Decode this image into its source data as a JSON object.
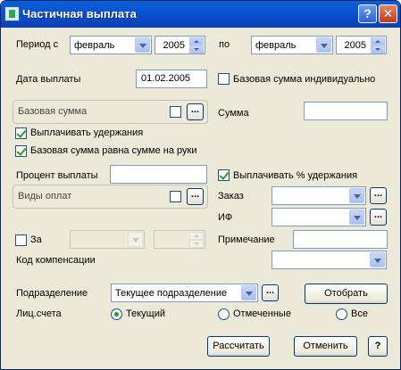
{
  "window": {
    "title": "Частичная выплата",
    "help_label": "?",
    "close_label": "✕"
  },
  "period": {
    "from_label": "Период с",
    "from_month": "февраль",
    "from_year": "2005",
    "to_label": "по",
    "to_month": "февраль",
    "to_year": "2005"
  },
  "payment_date": {
    "label": "Дата выплаты",
    "value": "01.02.2005"
  },
  "base_individual": {
    "label": "Базовая сумма индивидуально",
    "checked": false
  },
  "base_sum": {
    "label": "Базовая сумма",
    "checked": false,
    "ellipsis": "..."
  },
  "sum": {
    "label": "Сумма",
    "value": ""
  },
  "pay_deductions": {
    "label": "Выплачивать удержания",
    "checked": true
  },
  "base_equals_net": {
    "label": "Базовая сумма равна сумме на руки",
    "checked": true
  },
  "payment_percent": {
    "label": "Процент выплаты",
    "value": ""
  },
  "pay_percent_deductions": {
    "label": "Выплачивать % удержания",
    "checked": true
  },
  "payment_types": {
    "label": "Виды оплат",
    "checked": false,
    "ellipsis": "..."
  },
  "order": {
    "label": "Заказ",
    "value": "",
    "ellipsis": "..."
  },
  "if_field": {
    "label": "ИФ",
    "value": "",
    "ellipsis": "..."
  },
  "for_period": {
    "label": "За",
    "checked": false,
    "month": "",
    "year": ""
  },
  "note": {
    "label": "Примечание",
    "value": ""
  },
  "compensation": {
    "label": "Код компенсации",
    "value": ""
  },
  "department": {
    "label": "Подразделение",
    "value": "Текущее подразделение",
    "ellipsis": "..."
  },
  "select_button": "Отобрать",
  "accounts": {
    "label": "Лиц.счета",
    "options": [
      "Текущий",
      "Отмеченные",
      "Все"
    ],
    "selected": "Текущий"
  },
  "footer": {
    "calc_label": "Рассчитать",
    "cancel_label": "Отменить",
    "help_label": "?"
  }
}
